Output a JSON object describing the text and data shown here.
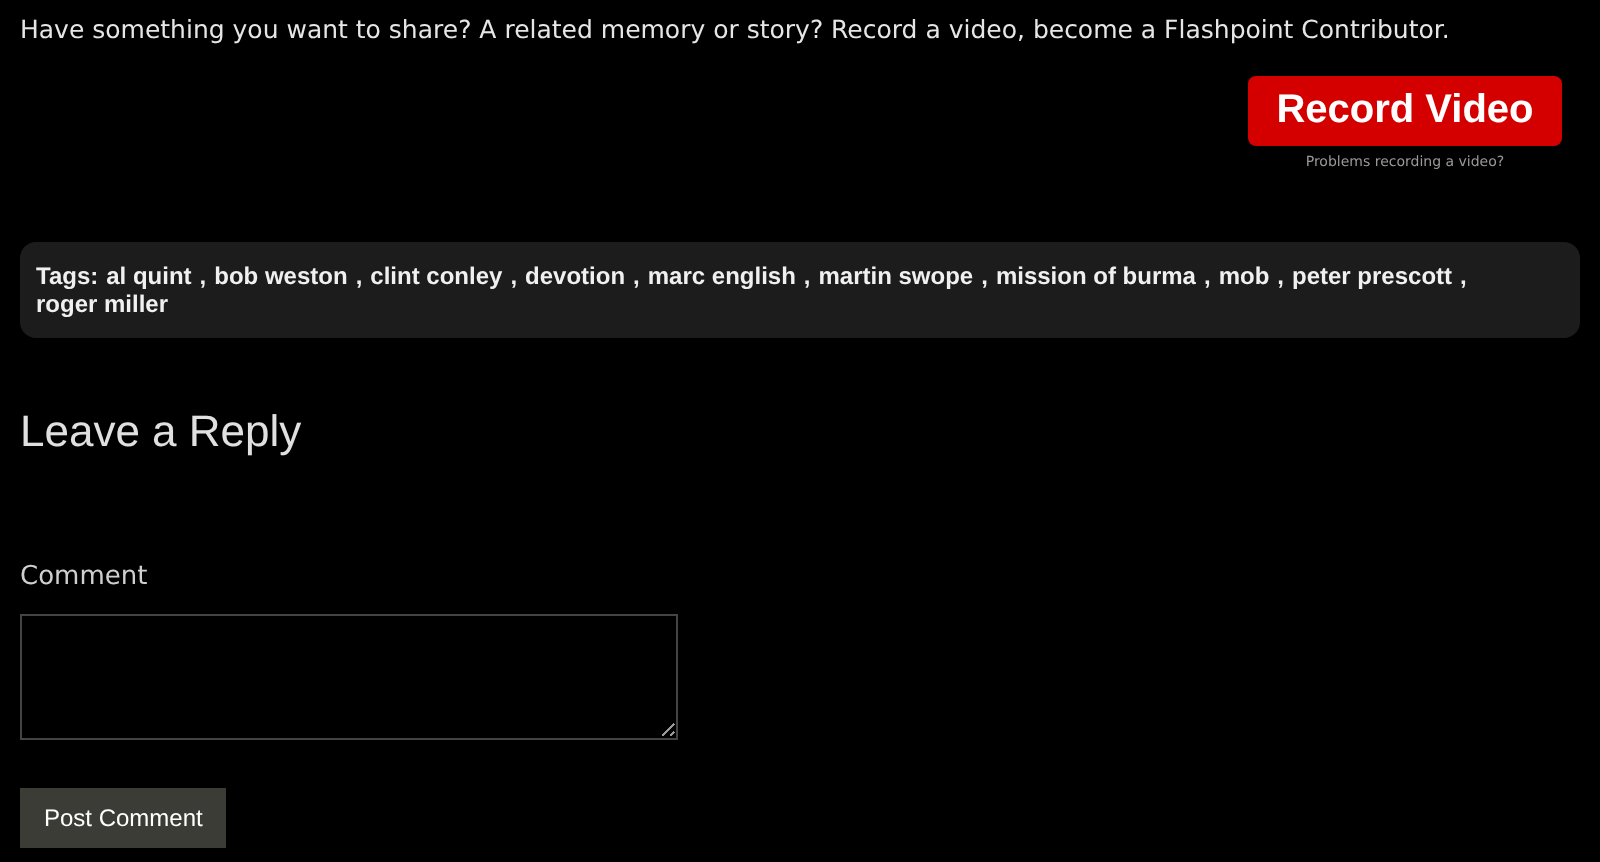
{
  "intro": "Have something you want to share? A related memory or story? Record a video, become a Flashpoint Contributor.",
  "record_button": "Record Video",
  "record_help": "Problems recording a video?",
  "tags": {
    "label": "Tags:",
    "separator": ",",
    "items": [
      "al quint",
      "bob weston",
      "clint conley",
      "devotion",
      "marc english",
      "martin swope",
      "mission of burma",
      "mob",
      "peter prescott",
      "roger miller"
    ]
  },
  "reply": {
    "title": "Leave a Reply",
    "comment_label": "Comment",
    "submit": "Post Comment"
  }
}
